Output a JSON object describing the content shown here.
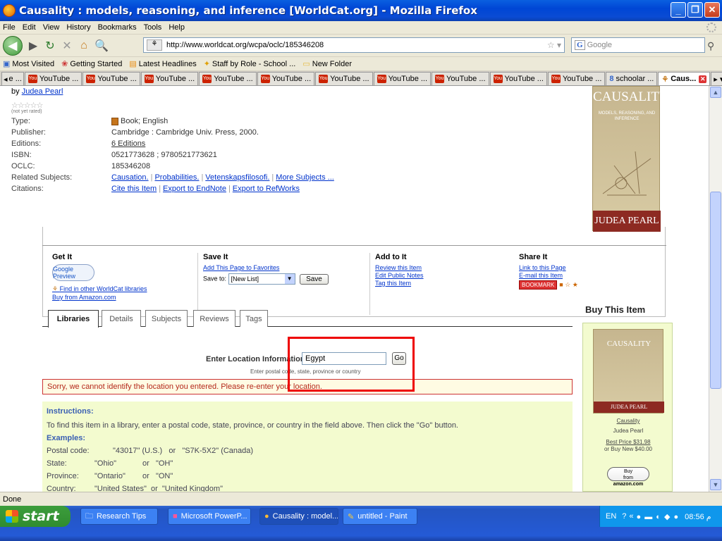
{
  "window": {
    "title": "Causality : models, reasoning, and inference [WorldCat.org] - Mozilla Firefox"
  },
  "menu": [
    "File",
    "Edit",
    "View",
    "History",
    "Bookmarks",
    "Tools",
    "Help"
  ],
  "nav": {
    "url": "http://www.worldcat.org/wcpa/oclc/185346208",
    "search_placeholder": "Google"
  },
  "bookmarks": [
    "Most Visited",
    "Getting Started",
    "Latest Headlines",
    "Staff by Role - School ...",
    "New Folder"
  ],
  "tabs": {
    "first": "e ...",
    "youtube": "YouTube ...",
    "scholar": "schoolar ...",
    "active": "Caus..."
  },
  "record": {
    "by": "by",
    "author": "Judea Pearl",
    "rating_note": "(not yet rated)",
    "rows": [
      {
        "key": "Type:",
        "value": "Book; English"
      },
      {
        "key": "Publisher:",
        "value": "Cambridge : Cambridge Univ. Press, 2000."
      },
      {
        "key": "Editions:",
        "value": "6 Editions"
      },
      {
        "key": "ISBN:",
        "value": "0521773628 ; 9780521773621"
      },
      {
        "key": "OCLC:",
        "value": "185346208"
      },
      {
        "key": "Related Subjects:",
        "value": ""
      },
      {
        "key": "Citations:",
        "value": ""
      }
    ],
    "subjects": [
      "Causation.",
      "Probabilities.",
      "Vetenskapsfilosofi.",
      "More Subjects ..."
    ],
    "citations": [
      "Cite this Item",
      "Export to EndNote",
      "Export to RefWorks"
    ],
    "cover": {
      "title": "CAUSALITY",
      "subtitle": "MODELS, REASONING, AND INFERENCE",
      "author": "JUDEA PEARL"
    }
  },
  "actions": {
    "get_it": {
      "title": "Get It",
      "preview": "Google Preview",
      "links": [
        "Find in other WorldCat libraries",
        "Buy from Amazon.com"
      ]
    },
    "save_it": {
      "title": "Save It",
      "link": "Add This Page to Favorites",
      "label": "Save to:",
      "list": "[New List]",
      "button": "Save"
    },
    "add_to_it": {
      "title": "Add to It",
      "links": [
        "Review this Item",
        "Edit Public Notes",
        "Tag this Item"
      ]
    },
    "share_it": {
      "title": "Share It",
      "links": [
        "Link to this Page",
        "E-mail this Item"
      ],
      "bookmark": "BOOKMARK"
    }
  },
  "lib_tabs": [
    "Libraries",
    "Details",
    "Subjects",
    "Reviews",
    "Tags"
  ],
  "location": {
    "label": "Enter Location Information:",
    "value": "Egypt",
    "button": "Go",
    "hint": "Enter postal code, state, province or country",
    "error": "Sorry, we cannot identify the location you entered. Please re-enter your location."
  },
  "instructions": {
    "heading": "Instructions:",
    "text": "To find this item in a library, enter a postal code, state, province, or country in the field above. Then click the \"Go\" button.",
    "examples_heading": "Examples:",
    "examples": [
      {
        "label": "Postal code:",
        "a": "\"43017\" (U.S.)",
        "or": "or",
        "b": "\"S7K-5X2\" (Canada)"
      },
      {
        "label": "State:",
        "a": "\"Ohio\"",
        "or": "or",
        "b": "\"OH\""
      },
      {
        "label": "Province:",
        "a": "\"Ontario\"",
        "or": "or",
        "b": "\"ON\""
      },
      {
        "label": "Country:",
        "a": "\"United States\"",
        "or": "or",
        "b": "\"United Kingdom\""
      }
    ]
  },
  "buy": {
    "title": "Buy This Item",
    "cover_title": "CAUSALITY",
    "cover_author": "JUDEA PEARL",
    "item": "Causality",
    "author": "Judea Pearl",
    "price": "Best Price $31.98",
    "new_price": "or Buy New $40.00",
    "button_top": "Buy",
    "button_from": "from",
    "button_brand": "amazon.com"
  },
  "status": "Done",
  "taskbar": {
    "start": "start",
    "items": [
      "Research Tips",
      "Microsoft PowerP...",
      "Causality : model...",
      "untitled - Paint"
    ],
    "lang": "EN",
    "clock": "08:56 م"
  }
}
